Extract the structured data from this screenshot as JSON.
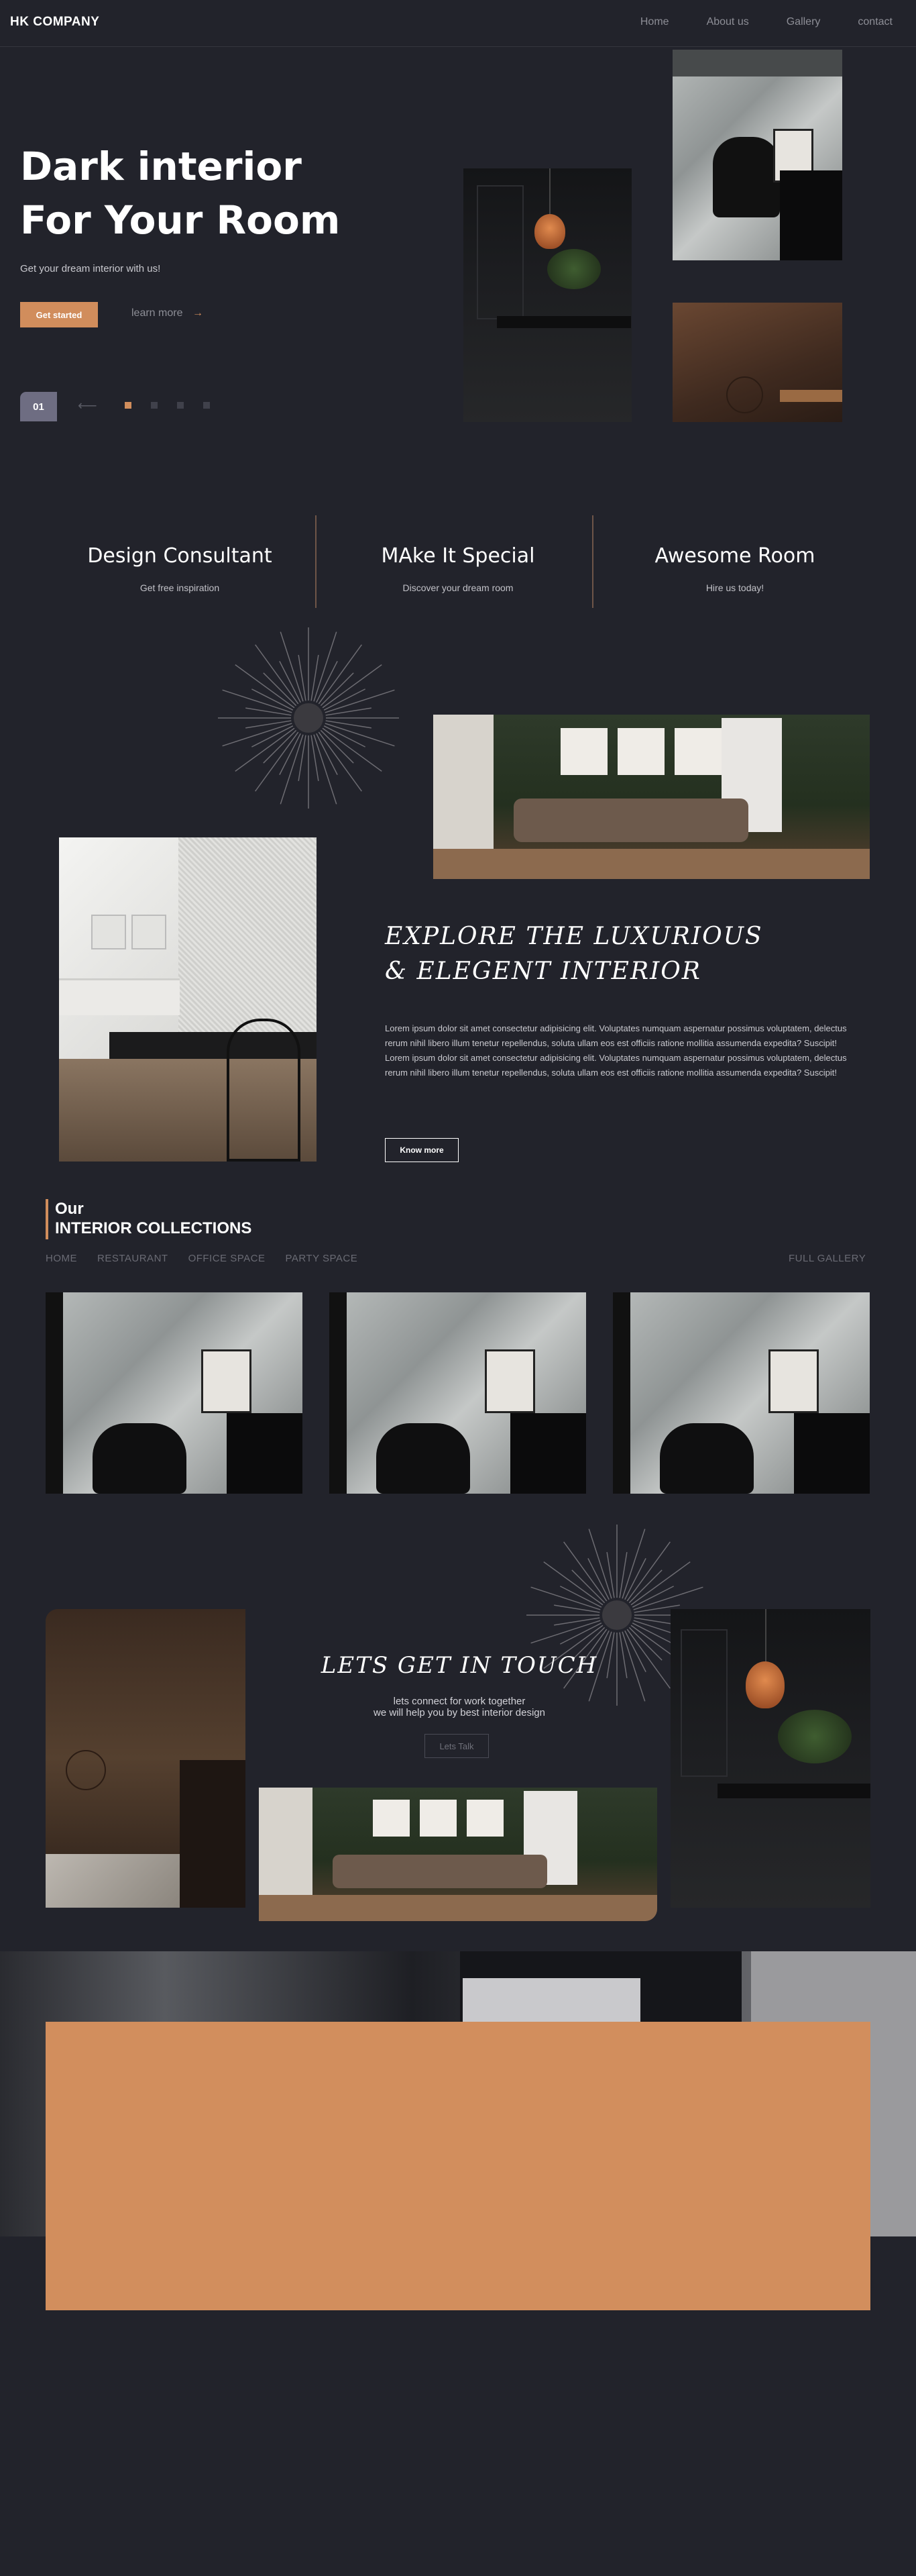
{
  "nav": {
    "brand": "HK COMPANY",
    "links": [
      "Home",
      "About us",
      "Gallery",
      "contact"
    ]
  },
  "hero": {
    "title_line1": "Dark interior",
    "title_line2": "For Your Room",
    "subtitle": "Get your dream interior with us!",
    "start_label": "Get started",
    "learn_label": "learn more",
    "slide_number": "01"
  },
  "features": [
    {
      "title": "Design Consultant",
      "subtitle": "Get free inspiration"
    },
    {
      "title": "MAke It Special",
      "subtitle": "Discover your dream room"
    },
    {
      "title": "Awesome Room",
      "subtitle": "Hire us today!"
    }
  ],
  "explore": {
    "title_line1": "EXPLORE THE LUXURIOUS",
    "title_line2": "& ELEGENT INTERIOR",
    "body": "Lorem ipsum dolor sit amet consectetur adipisicing elit. Voluptates numquam aspernatur possimus voluptatem, delectus rerum nihil libero illum tenetur repellendus, soluta ullam eos est officiis ratione mollitia assumenda expedita? Suscipit! Lorem ipsum dolor sit amet consectetur adipisicing elit. Voluptates numquam aspernatur possimus voluptatem, delectus rerum nihil libero illum tenetur repellendus, soluta ullam eos est officiis ratione mollitia assumenda expedita? Suscipit!",
    "button_label": "Know more"
  },
  "collections": {
    "our": "Our",
    "title": "INTERIOR COLLECTIONS",
    "tabs": [
      "HOME",
      "RESTAURANT",
      "OFFICE SPACE",
      "PARTY SPACE"
    ],
    "gallery_link": "FULL GALLERY"
  },
  "contact": {
    "title": "LETS GET IN TOUCH",
    "line1": "lets connect for work together",
    "line2": "we will help you by best interior design",
    "button_label": "Lets Talk"
  },
  "colors": {
    "background": "#22232b",
    "accent": "#d18d5c",
    "slide_badge": "#6e6d82"
  }
}
